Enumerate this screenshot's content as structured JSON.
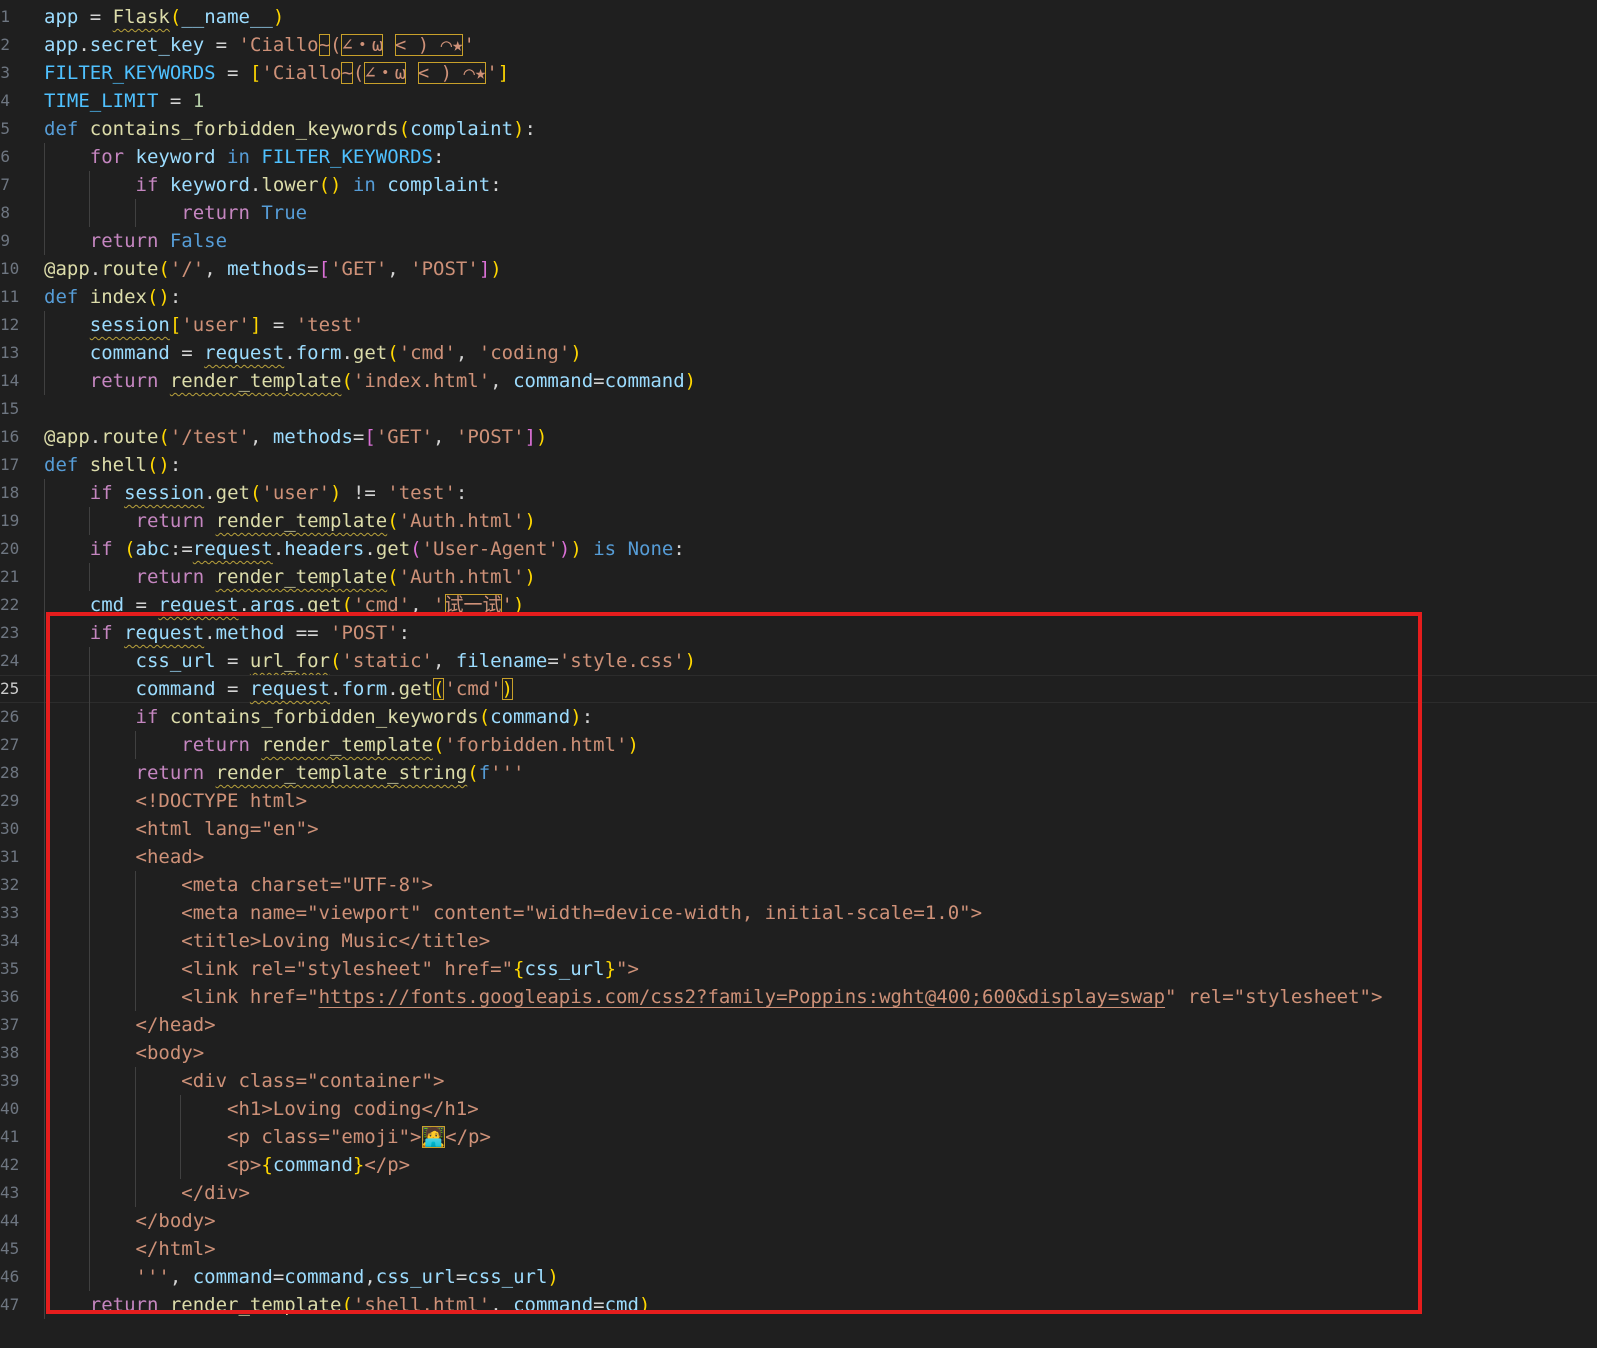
{
  "editor": {
    "language": "python",
    "active_line_index": 24,
    "highlight_box_color": "#e51d1d"
  },
  "lines": [
    {
      "n": "1",
      "t": [
        [
          "var",
          "app"
        ],
        [
          "op",
          " = "
        ],
        [
          "fn sq",
          "Flask"
        ],
        [
          "br1",
          "("
        ],
        [
          "var",
          "__name__"
        ],
        [
          "br1",
          ")"
        ]
      ]
    },
    {
      "n": "2",
      "t": [
        [
          "var",
          "app"
        ],
        [
          "op",
          "."
        ],
        [
          "var",
          "secret_key"
        ],
        [
          "op",
          " = "
        ],
        [
          "str",
          "'Ciallo"
        ],
        [
          "str box",
          "~"
        ],
        [
          "str",
          "("
        ],
        [
          "str box",
          "∠・ω"
        ],
        [
          "str",
          " "
        ],
        [
          "str box",
          "< ) ⌒★"
        ],
        [
          "str",
          "'"
        ]
      ]
    },
    {
      "n": "3",
      "t": [
        [
          "cst",
          "FILTER_KEYWORDS"
        ],
        [
          "op",
          " = "
        ],
        [
          "br1",
          "["
        ],
        [
          "str",
          "'Ciallo"
        ],
        [
          "str box",
          "~"
        ],
        [
          "str",
          "("
        ],
        [
          "str box",
          "∠・ω"
        ],
        [
          "str",
          " "
        ],
        [
          "str box",
          "< ) ⌒★"
        ],
        [
          "str",
          "'"
        ],
        [
          "br1",
          "]"
        ]
      ]
    },
    {
      "n": "4",
      "t": [
        [
          "cst",
          "TIME_LIMIT"
        ],
        [
          "op",
          " = "
        ],
        [
          "num",
          "1"
        ]
      ]
    },
    {
      "n": "5",
      "t": [
        [
          "kw",
          "def "
        ],
        [
          "fn",
          "contains_forbidden_keywords"
        ],
        [
          "br1",
          "("
        ],
        [
          "var",
          "complaint"
        ],
        [
          "br1",
          ")"
        ],
        [
          "op",
          ":"
        ]
      ]
    },
    {
      "n": "6",
      "t": [
        [
          "op",
          "    "
        ],
        [
          "kc",
          "for "
        ],
        [
          "var",
          "keyword"
        ],
        [
          "kw",
          " in "
        ],
        [
          "cst",
          "FILTER_KEYWORDS"
        ],
        [
          "op",
          ":"
        ]
      ]
    },
    {
      "n": "7",
      "t": [
        [
          "op",
          "        "
        ],
        [
          "kc",
          "if "
        ],
        [
          "var",
          "keyword"
        ],
        [
          "op",
          "."
        ],
        [
          "fn",
          "lower"
        ],
        [
          "br1",
          "()"
        ],
        [
          "kw",
          " in "
        ],
        [
          "var",
          "complaint"
        ],
        [
          "op",
          ":"
        ]
      ]
    },
    {
      "n": "8",
      "t": [
        [
          "op",
          "            "
        ],
        [
          "kc",
          "return "
        ],
        [
          "kw",
          "True"
        ]
      ]
    },
    {
      "n": "9",
      "t": [
        [
          "op",
          "    "
        ],
        [
          "kc",
          "return "
        ],
        [
          "kw",
          "False"
        ]
      ]
    },
    {
      "n": "10",
      "t": [
        [
          "fn",
          "@app"
        ],
        [
          "op",
          "."
        ],
        [
          "fn",
          "route"
        ],
        [
          "br1",
          "("
        ],
        [
          "str",
          "'/'"
        ],
        [
          "op",
          ", "
        ],
        [
          "var",
          "methods"
        ],
        [
          "op",
          "="
        ],
        [
          "br2",
          "["
        ],
        [
          "str",
          "'GET'"
        ],
        [
          "op",
          ", "
        ],
        [
          "str",
          "'POST'"
        ],
        [
          "br2",
          "]"
        ],
        [
          "br1",
          ")"
        ]
      ]
    },
    {
      "n": "11",
      "t": [
        [
          "kw",
          "def "
        ],
        [
          "fn",
          "index"
        ],
        [
          "br1",
          "()"
        ],
        [
          "op",
          ":"
        ]
      ]
    },
    {
      "n": "12",
      "t": [
        [
          "op",
          "    "
        ],
        [
          "var sq",
          "session"
        ],
        [
          "br1",
          "["
        ],
        [
          "str",
          "'user'"
        ],
        [
          "br1",
          "]"
        ],
        [
          "op",
          " = "
        ],
        [
          "str",
          "'test'"
        ]
      ]
    },
    {
      "n": "13",
      "t": [
        [
          "op",
          "    "
        ],
        [
          "var",
          "command"
        ],
        [
          "op",
          " = "
        ],
        [
          "var sq",
          "request"
        ],
        [
          "op",
          "."
        ],
        [
          "var",
          "form"
        ],
        [
          "op",
          "."
        ],
        [
          "fn",
          "get"
        ],
        [
          "br1",
          "("
        ],
        [
          "str",
          "'cmd'"
        ],
        [
          "op",
          ", "
        ],
        [
          "str",
          "'coding'"
        ],
        [
          "br1",
          ")"
        ]
      ]
    },
    {
      "n": "14",
      "t": [
        [
          "op",
          "    "
        ],
        [
          "kc",
          "return "
        ],
        [
          "fn sq",
          "render_template"
        ],
        [
          "br1",
          "("
        ],
        [
          "str",
          "'index.html'"
        ],
        [
          "op",
          ", "
        ],
        [
          "var",
          "command"
        ],
        [
          "op",
          "="
        ],
        [
          "var",
          "command"
        ],
        [
          "br1",
          ")"
        ]
      ]
    },
    {
      "n": "15",
      "t": []
    },
    {
      "n": "16",
      "t": [
        [
          "fn",
          "@app"
        ],
        [
          "op",
          "."
        ],
        [
          "fn",
          "route"
        ],
        [
          "br1",
          "("
        ],
        [
          "str",
          "'/test'"
        ],
        [
          "op",
          ", "
        ],
        [
          "var",
          "methods"
        ],
        [
          "op",
          "="
        ],
        [
          "br2",
          "["
        ],
        [
          "str",
          "'GET'"
        ],
        [
          "op",
          ", "
        ],
        [
          "str",
          "'POST'"
        ],
        [
          "br2",
          "]"
        ],
        [
          "br1",
          ")"
        ]
      ]
    },
    {
      "n": "17",
      "t": [
        [
          "kw",
          "def "
        ],
        [
          "fn",
          "shell"
        ],
        [
          "br1",
          "()"
        ],
        [
          "op",
          ":"
        ]
      ]
    },
    {
      "n": "18",
      "t": [
        [
          "op",
          "    "
        ],
        [
          "kc",
          "if "
        ],
        [
          "var sq",
          "session"
        ],
        [
          "op",
          "."
        ],
        [
          "fn",
          "get"
        ],
        [
          "br1",
          "("
        ],
        [
          "str",
          "'user'"
        ],
        [
          "br1",
          ")"
        ],
        [
          "op",
          " != "
        ],
        [
          "str",
          "'test'"
        ],
        [
          "op",
          ":"
        ]
      ]
    },
    {
      "n": "19",
      "t": [
        [
          "op",
          "        "
        ],
        [
          "kc",
          "return "
        ],
        [
          "fn sq",
          "render_template"
        ],
        [
          "br1",
          "("
        ],
        [
          "str",
          "'Auth.html'"
        ],
        [
          "br1",
          ")"
        ]
      ]
    },
    {
      "n": "20",
      "t": [
        [
          "op",
          "    "
        ],
        [
          "kc",
          "if "
        ],
        [
          "br1",
          "("
        ],
        [
          "var",
          "abc"
        ],
        [
          "op",
          ":="
        ],
        [
          "var sq",
          "request"
        ],
        [
          "op",
          "."
        ],
        [
          "var",
          "headers"
        ],
        [
          "op",
          "."
        ],
        [
          "fn",
          "get"
        ],
        [
          "br2",
          "("
        ],
        [
          "str",
          "'User-Agent'"
        ],
        [
          "br2",
          ")"
        ],
        [
          "br1",
          ")"
        ],
        [
          "kw",
          " is "
        ],
        [
          "kw",
          "None"
        ],
        [
          "op",
          ":"
        ]
      ]
    },
    {
      "n": "21",
      "t": [
        [
          "op",
          "        "
        ],
        [
          "kc",
          "return "
        ],
        [
          "fn sq",
          "render_template"
        ],
        [
          "br1",
          "("
        ],
        [
          "str",
          "'Auth.html'"
        ],
        [
          "br1",
          ")"
        ]
      ]
    },
    {
      "n": "22",
      "t": [
        [
          "op",
          "    "
        ],
        [
          "var",
          "cmd"
        ],
        [
          "op",
          " = "
        ],
        [
          "var sq",
          "request"
        ],
        [
          "op",
          "."
        ],
        [
          "var",
          "args"
        ],
        [
          "op",
          "."
        ],
        [
          "fn",
          "get"
        ],
        [
          "br1",
          "("
        ],
        [
          "str",
          "'cmd'"
        ],
        [
          "op",
          ", "
        ],
        [
          "str",
          "'"
        ],
        [
          "str box",
          "试一试"
        ],
        [
          "str",
          "'"
        ],
        [
          "br1",
          ")"
        ]
      ]
    },
    {
      "n": "23",
      "t": [
        [
          "op",
          "    "
        ],
        [
          "kc",
          "if "
        ],
        [
          "var sq",
          "request"
        ],
        [
          "op",
          "."
        ],
        [
          "var",
          "method"
        ],
        [
          "op",
          " == "
        ],
        [
          "str",
          "'POST'"
        ],
        [
          "op",
          ":"
        ]
      ]
    },
    {
      "n": "24",
      "t": [
        [
          "op",
          "        "
        ],
        [
          "var",
          "css_url"
        ],
        [
          "op",
          " = "
        ],
        [
          "fn sq",
          "url_for"
        ],
        [
          "br1",
          "("
        ],
        [
          "str",
          "'static'"
        ],
        [
          "op",
          ", "
        ],
        [
          "var",
          "filename"
        ],
        [
          "op",
          "="
        ],
        [
          "str",
          "'style.css'"
        ],
        [
          "br1",
          ")"
        ]
      ]
    },
    {
      "n": "25",
      "t": [
        [
          "op",
          "        "
        ],
        [
          "var",
          "command"
        ],
        [
          "op",
          " = "
        ],
        [
          "var sq",
          "request"
        ],
        [
          "op",
          "."
        ],
        [
          "var",
          "form"
        ],
        [
          "op",
          "."
        ],
        [
          "fn",
          "get"
        ],
        [
          "br1 box",
          "("
        ],
        [
          "str",
          "'cmd'"
        ],
        [
          "br1 box",
          ")"
        ]
      ]
    },
    {
      "n": "26",
      "t": [
        [
          "op",
          "        "
        ],
        [
          "kc",
          "if "
        ],
        [
          "fn",
          "contains_forbidden_keywords"
        ],
        [
          "br1",
          "("
        ],
        [
          "var",
          "command"
        ],
        [
          "br1",
          ")"
        ],
        [
          "op",
          ":"
        ]
      ]
    },
    {
      "n": "27",
      "t": [
        [
          "op",
          "            "
        ],
        [
          "kc",
          "return "
        ],
        [
          "fn sq",
          "render_template"
        ],
        [
          "br1",
          "("
        ],
        [
          "str",
          "'forbidden.html'"
        ],
        [
          "br1",
          ")"
        ]
      ]
    },
    {
      "n": "28",
      "t": [
        [
          "op",
          "        "
        ],
        [
          "kc",
          "return "
        ],
        [
          "fn sq",
          "render_template_string"
        ],
        [
          "br1",
          "("
        ],
        [
          "kw",
          "f"
        ],
        [
          "str",
          "'''"
        ]
      ]
    },
    {
      "n": "29",
      "t": [
        [
          "op",
          "        "
        ],
        [
          "str",
          "<!DOCTYPE html>"
        ]
      ]
    },
    {
      "n": "30",
      "t": [
        [
          "op",
          "        "
        ],
        [
          "str",
          "<html lang=\"en\">"
        ]
      ]
    },
    {
      "n": "31",
      "t": [
        [
          "op",
          "        "
        ],
        [
          "str",
          "<head>"
        ]
      ]
    },
    {
      "n": "32",
      "t": [
        [
          "op",
          "            "
        ],
        [
          "str",
          "<meta charset=\"UTF-8\">"
        ]
      ]
    },
    {
      "n": "33",
      "t": [
        [
          "op",
          "            "
        ],
        [
          "str",
          "<meta name=\"viewport\" content=\"width=device-width, initial-scale=1.0\">"
        ]
      ]
    },
    {
      "n": "34",
      "t": [
        [
          "op",
          "            "
        ],
        [
          "str",
          "<title>Loving Music</title>"
        ]
      ]
    },
    {
      "n": "35",
      "t": [
        [
          "op",
          "            "
        ],
        [
          "str",
          "<link rel=\"stylesheet\" href=\""
        ],
        [
          "br1",
          "{"
        ],
        [
          "var",
          "css_url"
        ],
        [
          "br1",
          "}"
        ],
        [
          "str",
          "\">"
        ]
      ]
    },
    {
      "n": "36",
      "t": [
        [
          "op",
          "            "
        ],
        [
          "str",
          "<link href=\""
        ],
        [
          "str lnk",
          "https://fonts.googleapis.com/css2?family=Poppins:wght@400;600&display=swap"
        ],
        [
          "str",
          "\" rel=\"stylesheet\">"
        ]
      ]
    },
    {
      "n": "37",
      "t": [
        [
          "op",
          "        "
        ],
        [
          "str",
          "</head>"
        ]
      ]
    },
    {
      "n": "38",
      "t": [
        [
          "op",
          "        "
        ],
        [
          "str",
          "<body>"
        ]
      ]
    },
    {
      "n": "39",
      "t": [
        [
          "op",
          "            "
        ],
        [
          "str",
          "<div class=\"container\">"
        ]
      ]
    },
    {
      "n": "40",
      "t": [
        [
          "op",
          "                "
        ],
        [
          "str",
          "<h1>Loving coding</h1>"
        ]
      ]
    },
    {
      "n": "41",
      "t": [
        [
          "op",
          "                "
        ],
        [
          "str",
          "<p class=\"emoji\">"
        ],
        [
          "str box",
          "🧑‍💻"
        ],
        [
          "str",
          "</p>"
        ]
      ]
    },
    {
      "n": "42",
      "t": [
        [
          "op",
          "                "
        ],
        [
          "str",
          "<p>"
        ],
        [
          "br1",
          "{"
        ],
        [
          "var",
          "command"
        ],
        [
          "br1",
          "}"
        ],
        [
          "str",
          "</p>"
        ]
      ]
    },
    {
      "n": "43",
      "t": [
        [
          "op",
          "            "
        ],
        [
          "str",
          "</div>"
        ]
      ]
    },
    {
      "n": "44",
      "t": [
        [
          "op",
          "        "
        ],
        [
          "str",
          "</body>"
        ]
      ]
    },
    {
      "n": "45",
      "t": [
        [
          "op",
          "        "
        ],
        [
          "str",
          "</html>"
        ]
      ]
    },
    {
      "n": "46",
      "t": [
        [
          "op",
          "        "
        ],
        [
          "str",
          "'''"
        ],
        [
          "op",
          ", "
        ],
        [
          "var",
          "command"
        ],
        [
          "op",
          "="
        ],
        [
          "var",
          "command"
        ],
        [
          "op",
          ","
        ],
        [
          "var",
          "css_url"
        ],
        [
          "op",
          "="
        ],
        [
          "var",
          "css_url"
        ],
        [
          "br1",
          ")"
        ]
      ]
    },
    {
      "n": "47",
      "t": [
        [
          "op",
          "    "
        ],
        [
          "kc",
          "return "
        ],
        [
          "fn",
          "render_template"
        ],
        [
          "br1",
          "("
        ],
        [
          "str",
          "'shell.html'"
        ],
        [
          "op",
          ", "
        ],
        [
          "var",
          "command"
        ],
        [
          "op",
          "="
        ],
        [
          "var",
          "cmd"
        ],
        [
          "br1",
          ")"
        ]
      ]
    }
  ]
}
